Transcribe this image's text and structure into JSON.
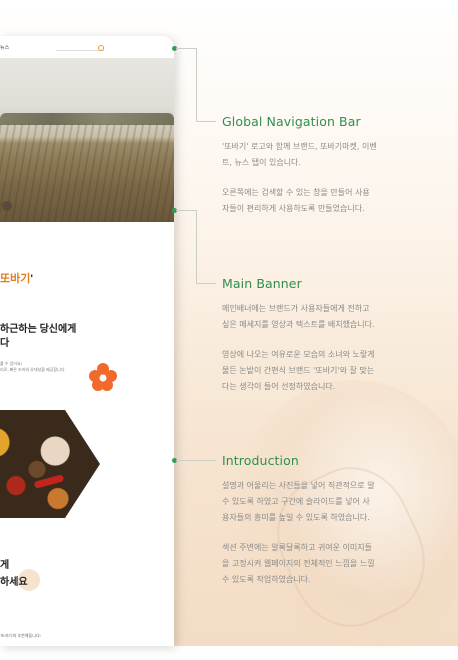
{
  "mockup": {
    "nav_label": "뉴스",
    "title_part1": "또바기",
    "title_part2": "'",
    "heading_lines": "하근하는 당신에게\n다",
    "sub_lines": "를 수 있어요!\n리로, 빠른 조리와 유대성을 제공합니다.",
    "bottom_heading_line1": "게",
    "bottom_heading_line2": "하세요",
    "footer_text": "'또바기'와 추천해줍니다!"
  },
  "sections": [
    {
      "title": "Global Navigation Bar",
      "paragraph1": "'또바기' 로고와 함께 브랜드, 또바기마켓, 이벤\n트, 뉴스 탭이 있습니다.",
      "paragraph2": "오른쪽에는 검색할 수 있는 창을 만들어 사용\n자들이 편리하게 사용하도록 만들었습니다."
    },
    {
      "title": "Main Banner",
      "paragraph1": "메인배너에는 브랜드가 사용자들에게 전하고\n싶은 메세지를 영상과 텍스트를 배치했습니다.",
      "paragraph2": "영상에 나오는 여유로운 모습의 소녀와 노랗게\n물든 논밭이 간편식 브랜드 '또바기'와 잘 맞는\n다는 생각이 들어 선정하였습니다."
    },
    {
      "title": "Introduction",
      "paragraph1": "설명과 어울리는 사진들을 넣어 직관적으로 알\n수 있도록 하였고 구간에 슬라이드를 넣어 사\n용자들의 흥미를 높일 수 있도록 하였습니다.",
      "paragraph2": "섹션 주변에는 알록달록하고 귀여운 이미지들\n을 고정시켜 웹페이지의 전체적인 느낌을 느낄\n수 있도록 작업하였습니다."
    }
  ],
  "colors": {
    "accent_green": "#2f8f4e",
    "brand_orange": "#e07e1c",
    "text_gray": "#8a8a8a"
  }
}
